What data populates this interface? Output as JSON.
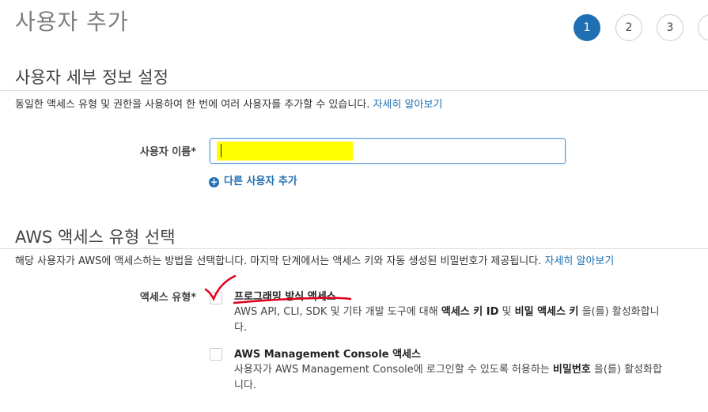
{
  "header": {
    "title": "사용자 추가",
    "steps": [
      "1",
      "2",
      "3"
    ]
  },
  "details": {
    "title": "사용자 세부 정보 설정",
    "description": "동일한 액세스 유형 및 권한을 사용하여 한 번에 여러 사용자를 추가할 수 있습니다.",
    "learn_more": "자세히 알아보기",
    "username_label": "사용자 이름*",
    "username_value": "",
    "add_user_link": "다른 사용자 추가"
  },
  "access": {
    "title": "AWS 액세스 유형 선택",
    "description": "해당 사용자가 AWS에 액세스하는 방법을 선택합니다. 마지막 단계에서는 액세스 키와 자동 생성된 비밀번호가 제공됩니다.",
    "learn_more": "자세히 알아보기",
    "type_label": "액세스 유형*",
    "options": [
      {
        "title": "프로그래밍 방식 액세스",
        "checked": false,
        "desc_1": "AWS API, CLI, SDK 및 기타 개발 도구에 대해 ",
        "desc_bold_1": "액세스 키 ID",
        "desc_2": " 및 ",
        "desc_bold_2": "비밀 액세스 키",
        "desc_3": " 을(를) 활성화합니다."
      },
      {
        "title": "AWS Management Console 액세스",
        "checked": false,
        "desc_1": "사용자가 AWS Management Console에 로그인할 수 있도록 허용하는 ",
        "desc_bold_1": "비밀번호",
        "desc_2": " 을(를) 활성화합니다."
      }
    ]
  },
  "colors": {
    "accent": "#1f6fb2",
    "redaction": "#ffff00",
    "annotation": "#e0001a"
  }
}
